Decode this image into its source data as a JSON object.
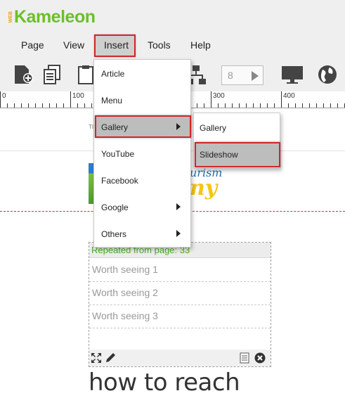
{
  "app": {
    "logo_prefix": "WEB",
    "logo_name": "Kameleon"
  },
  "menubar": {
    "page": "Page",
    "view": "View",
    "insert": "Insert",
    "tools": "Tools",
    "help": "Help"
  },
  "toolbar": {
    "icons": [
      "add-page-icon",
      "copy-page-icon",
      "paste-page-icon",
      "sitemap-icon",
      "monitor-icon",
      "globe-icon"
    ],
    "page_number": "8"
  },
  "ruler": {
    "labels": [
      "0",
      "100",
      "300",
      "400"
    ]
  },
  "insert_menu": {
    "items": [
      "Article",
      "Menu",
      "Gallery",
      "YouTube",
      "Facebook",
      "Google",
      "Others"
    ],
    "selected": "Gallery"
  },
  "gallery_submenu": {
    "items": [
      "Gallery",
      "Slideshow"
    ],
    "selected": "Slideshow"
  },
  "canvas": {
    "small_text": "TI",
    "banner_line1": "urism",
    "banner_line2": "ny",
    "repeated_label": "Repeated from page: 33",
    "rows": [
      "Worth seeing 1",
      "Worth seeing 2",
      "Worth seeing 3"
    ],
    "heading": "how to reach"
  },
  "colors": {
    "brand_green": "#6cbf2a",
    "highlight_red": "#d0262b",
    "repeat_green": "#4caf25",
    "banner_blue": "#1f6fb3",
    "banner_yellow": "#f5c518"
  }
}
